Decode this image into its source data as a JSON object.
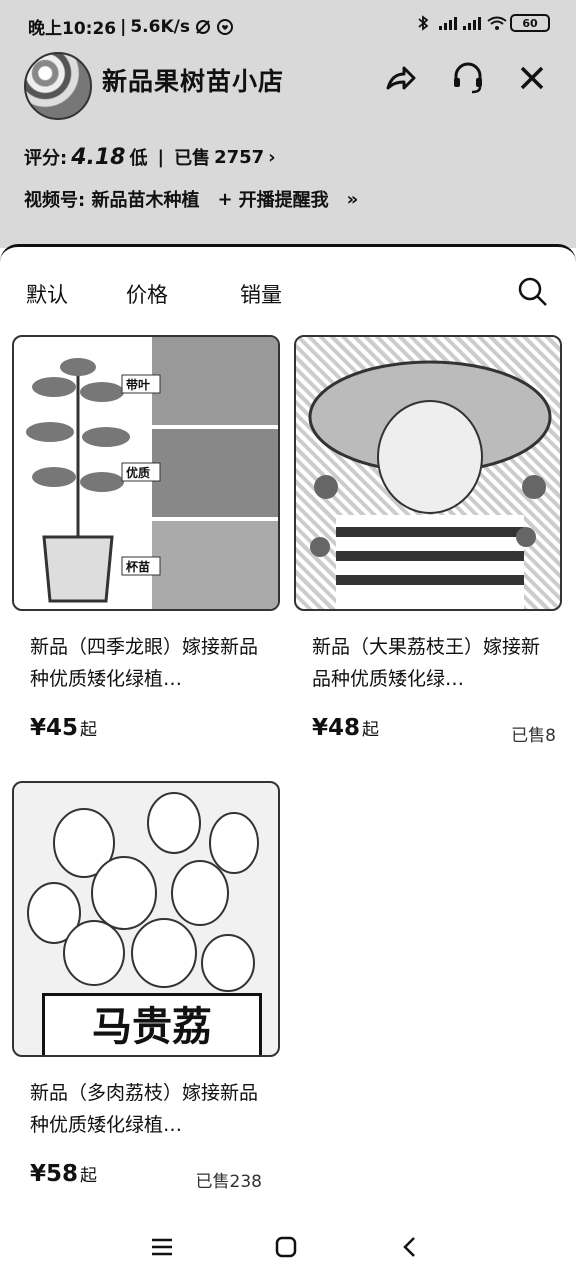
{
  "status_bar": {
    "time": "晚上10:26",
    "speed": "5.6K/s",
    "battery": "60"
  },
  "shop": {
    "name": "新品果树苗小店",
    "rating_label": "评分:",
    "rating_score": "4.18",
    "rating_level": "低",
    "sold_label": "已售",
    "sold_count": "2757",
    "channel_label": "视频号:",
    "channel_name": "新品苗木种植",
    "remind_label": "开播提醒我"
  },
  "sort": {
    "default": "默认",
    "price": "价格",
    "sales": "销量"
  },
  "products": [
    {
      "title": "新品（四季龙眼）嫁接新品种优质矮化绿植…",
      "price": "¥45",
      "price_suffix": "起",
      "sold": "",
      "image_labels": [
        "带叶",
        "优质",
        "杯苗"
      ]
    },
    {
      "title": "新品（大果荔枝王）嫁接新品种优质矮化绿…",
      "price": "¥48",
      "price_suffix": "起",
      "sold": "已售8"
    },
    {
      "title": "新品（多肉荔枝）嫁接新品种优质矮化绿植…",
      "price": "¥58",
      "price_suffix": "起",
      "sold": "已售238",
      "sign_text": "马贵荔"
    }
  ]
}
